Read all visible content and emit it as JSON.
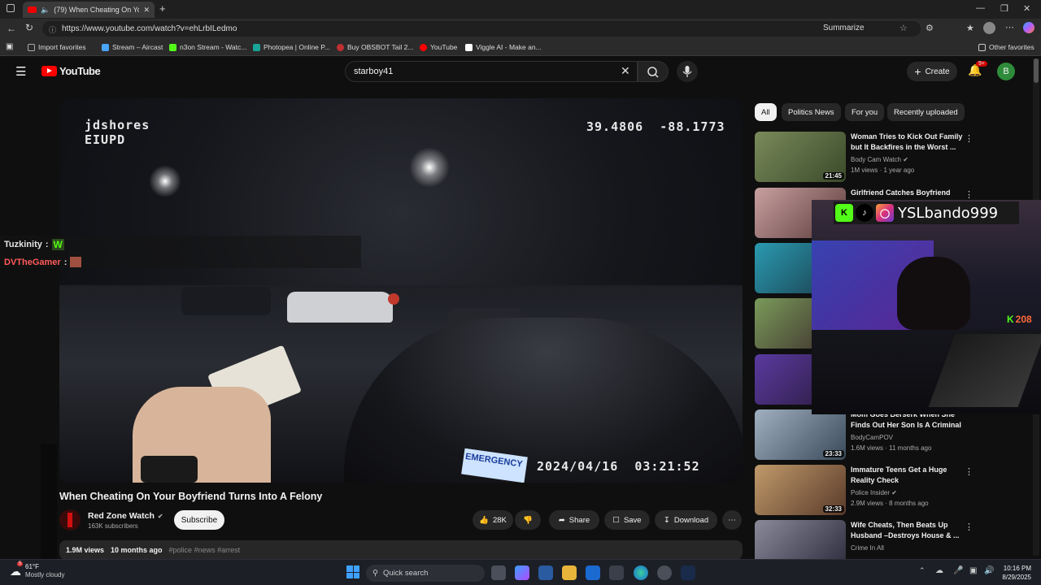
{
  "browser": {
    "tab_title": "(79) When Cheating On You",
    "url": "https://www.youtube.com/watch?v=ehLrbILedmo",
    "summarize_label": "Summarize",
    "favorites": [
      {
        "label": "Import favorites",
        "color": "#aaaaaa"
      },
      {
        "label": "Stream – Aircast",
        "color": "#4aa3ff"
      },
      {
        "label": "n3on Stream - Watc...",
        "color": "#53fc18"
      },
      {
        "label": "Photopea | Online P...",
        "color": "#18a497"
      },
      {
        "label": "Buy OBSBOT Tail 2...",
        "color": "#c03030"
      },
      {
        "label": "YouTube",
        "color": "#ff0000"
      },
      {
        "label": "Viggle AI - Make an...",
        "color": "#ffffff"
      }
    ],
    "other_favorites": "Other favorites"
  },
  "youtube": {
    "logo": "YouTube",
    "search_value": "starboy41",
    "create_label": "Create",
    "notif_badge": "9+",
    "avatar_letter": "B"
  },
  "video": {
    "overlay_user": "jdshores",
    "overlay_dept": "EIUPD",
    "overlay_coords": "39.4806  -88.1773",
    "overlay_datetime": "2024/04/16  03:21:52",
    "overlay_vehicle": "EMERGENCY",
    "title": "When Cheating On Your Boyfriend Turns Into A Felony",
    "channel": "Red Zone Watch",
    "subscribers": "163K subscribers",
    "subscribe_label": "Subscribe",
    "likes": "28K",
    "share_label": "Share",
    "save_label": "Save",
    "download_label": "Download",
    "views": "1.9M views",
    "age": "10 months ago",
    "hashtags": "#police #news #arrest"
  },
  "chat": [
    {
      "user": "Tuzkinity",
      "color": "#e6e6e6",
      "emote": "W",
      "emote_color": "#53fc18"
    },
    {
      "user": "DVTheGamer",
      "color": "#ff5a5a",
      "emote": "",
      "emote_color": "#a05040"
    }
  ],
  "chips": [
    "All",
    "Politics News",
    "For you",
    "Recently uploaded"
  ],
  "recommendations": [
    {
      "title": "Woman Tries to Kick Out Family but It Backfires in the Worst ...",
      "channel": "Body Cam Watch",
      "meta": "1M views · 1 year ago",
      "duration": "21:45",
      "thumb": "#5d7a3a"
    },
    {
      "title": "Girlfriend Catches Boyfriend",
      "channel": "",
      "meta": "",
      "duration": "",
      "thumb": "#8a6a6a"
    },
    {
      "title": "",
      "channel": "",
      "meta": "",
      "duration": "",
      "thumb": "#3a8a9a"
    },
    {
      "title": "",
      "channel": "",
      "meta": "",
      "duration": "",
      "thumb": "#6a7a4a"
    },
    {
      "title": "",
      "channel": "",
      "meta": "",
      "duration": "",
      "thumb": "#4a3a8a"
    },
    {
      "title": "Mom Goes Berserk When She Finds Out Her Son Is A Criminal",
      "channel": "BodyCamPOV",
      "meta": "1.6M views · 11 months ago",
      "duration": "23:33",
      "thumb": "#7a8aa0"
    },
    {
      "title": "Immature Teens Get a Huge Reality Check",
      "channel": "Police Insider",
      "meta": "2.9M views · 8 months ago",
      "duration": "32:33",
      "thumb": "#9a6a4a"
    },
    {
      "title": "Wife Cheats, Then Beats Up Husband –Destroys House & ...",
      "channel": "Crime In All",
      "meta": "",
      "duration": "",
      "thumb": "#5a5a6a"
    }
  ],
  "webcam": {
    "handle": "YSLbando999",
    "kick_count": "208"
  },
  "taskbar": {
    "weather_temp": "61°F",
    "weather_desc": "Mostly cloudy",
    "weather_badge": "5",
    "search_label": "Quick search",
    "time": "10:16 PM",
    "date": "8/29/2025"
  }
}
